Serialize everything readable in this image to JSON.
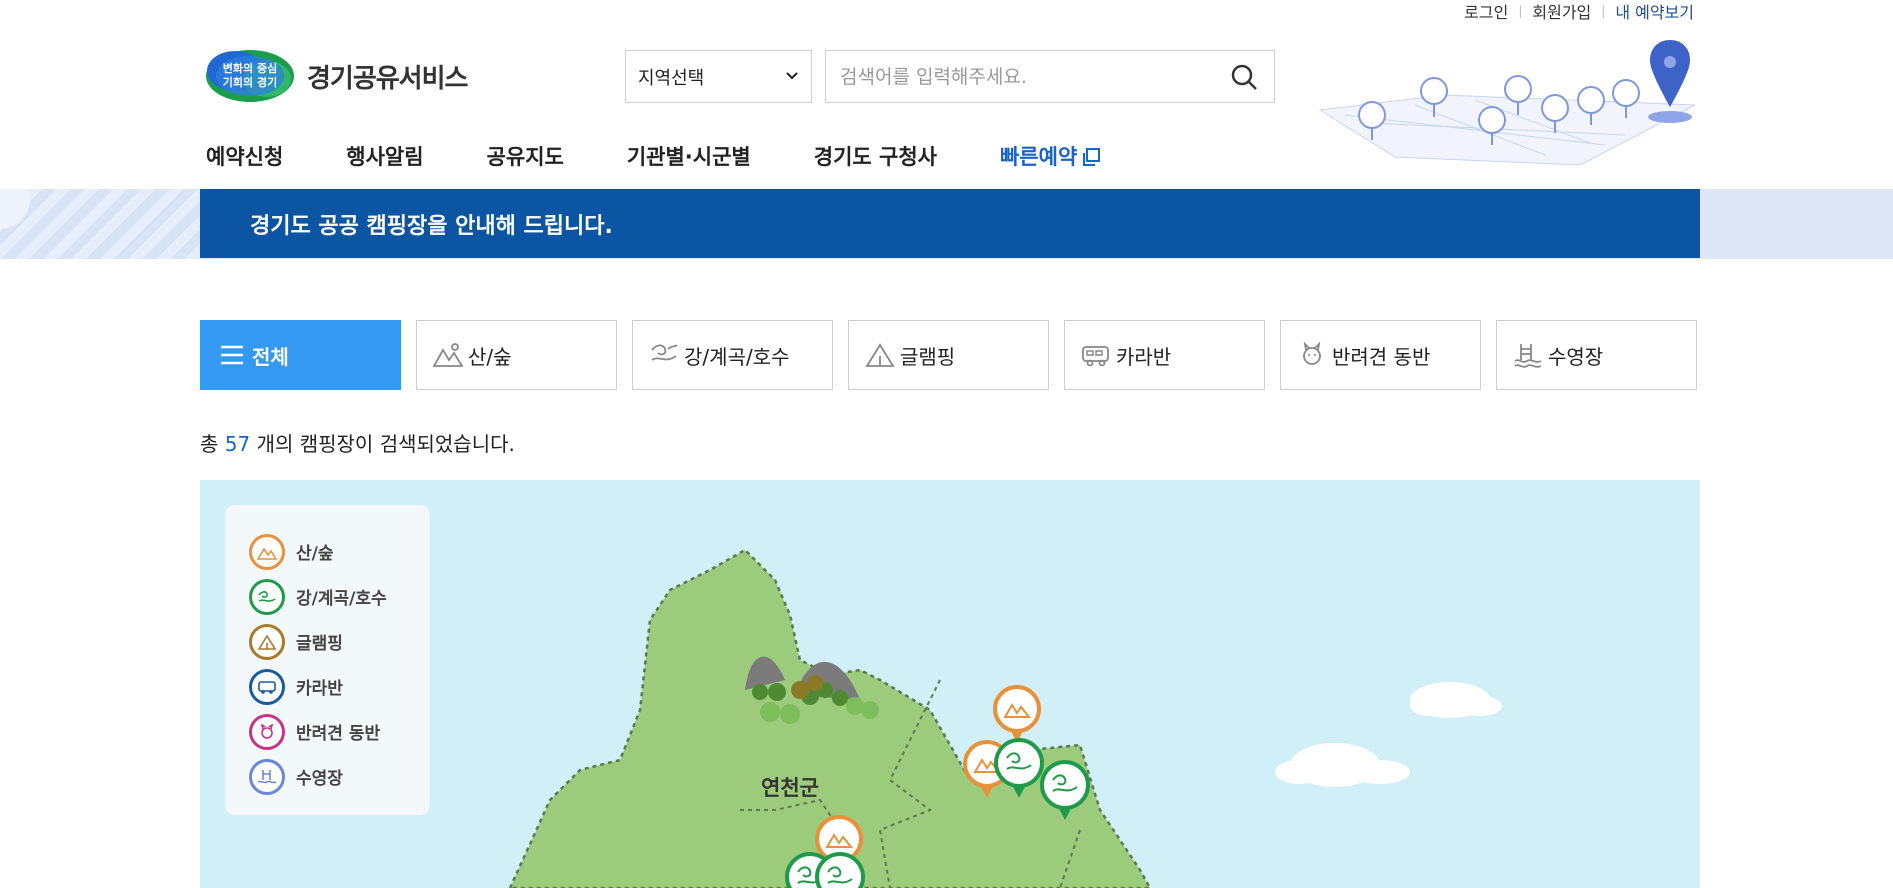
{
  "util": {
    "login": "로그인",
    "join": "회원가입",
    "my_reservation": "내 예약보기"
  },
  "logo": {
    "badge_line1": "변화의 중심",
    "badge_line2": "기회의 경기",
    "name": "경기공유서비스"
  },
  "region_select": {
    "value": "지역선택"
  },
  "search": {
    "placeholder": "검색어를 입력해주세요."
  },
  "gnb": [
    "예약신청",
    "행사알림",
    "공유지도",
    "기관별·시군별",
    "경기도 구청사"
  ],
  "gnb_quick": "빠른예약",
  "banner": {
    "text": "경기도 공공 캠핑장을 안내해 드립니다."
  },
  "tabs": [
    {
      "label": "전체",
      "icon": "menu-icon"
    },
    {
      "label": "산/숲",
      "icon": "mountain-icon"
    },
    {
      "label": "강/계곡/호수",
      "icon": "river-icon"
    },
    {
      "label": "글램핑",
      "icon": "tent-icon"
    },
    {
      "label": "카라반",
      "icon": "caravan-icon"
    },
    {
      "label": "반려견 동반",
      "icon": "pet-icon"
    },
    {
      "label": "수영장",
      "icon": "pool-icon"
    }
  ],
  "result": {
    "prefix": "총",
    "count": "57",
    "suffix": "개의 캠핑장이 검색되었습니다."
  },
  "legend": [
    {
      "label": "산/숲",
      "color": "#e8913a",
      "icon": "mountain-icon"
    },
    {
      "label": "강/계곡/호수",
      "color": "#1f9a4a",
      "icon": "river-icon"
    },
    {
      "label": "글램핑",
      "color": "#a87a2a",
      "icon": "tent-icon"
    },
    {
      "label": "카라반",
      "color": "#1a5aa0",
      "icon": "caravan-icon"
    },
    {
      "label": "반려견 동반",
      "color": "#c8338a",
      "icon": "pet-icon"
    },
    {
      "label": "수영장",
      "color": "#6a87d8",
      "icon": "pool-icon"
    }
  ],
  "map": {
    "region_label": "연천군"
  },
  "colors": {
    "brand_blue": "#0c55a3",
    "active_tab": "#3399f3",
    "accent_text": "#1a63c7",
    "map_sea": "#d0eff6",
    "map_land": "#9dcb7c"
  }
}
